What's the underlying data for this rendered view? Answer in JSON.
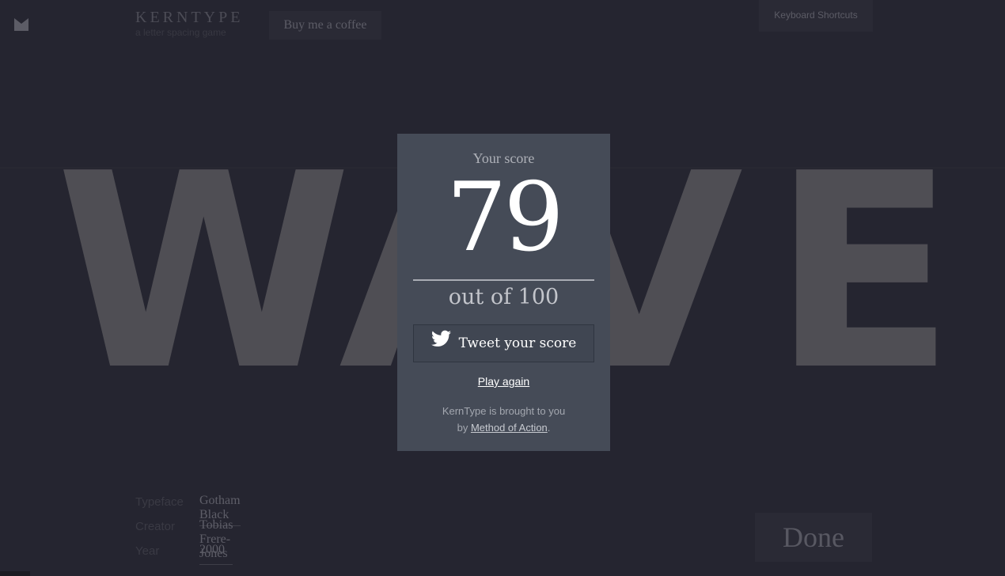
{
  "header": {
    "logo_icon": "m-logo-icon",
    "brand_title": "KERNTYPE",
    "brand_subtitle": "a letter spacing game",
    "coffee_label": "Buy me a coffee",
    "shortcuts_label": "Keyboard Shortcuts"
  },
  "game": {
    "word_letters": [
      "W",
      "A",
      "V",
      "E"
    ]
  },
  "meta": {
    "typeface_label": "Typeface",
    "typeface_value": "Gotham Black",
    "creator_label": "Creator",
    "creator_value": "Tobias Frere-Jones",
    "year_label": "Year",
    "year_value": "2000"
  },
  "done_label": "Done",
  "score_panel": {
    "label": "Your score",
    "score": "79",
    "total": "out of 100",
    "tweet_icon": "twitter-bird-icon",
    "tweet_label": "Tweet your score",
    "play_again": "Play again",
    "credit_line1": "KernType is brought to you",
    "credit_by": "by ",
    "credit_link": "Method of Action",
    "credit_end": "."
  },
  "colors": {
    "background": "#252530",
    "panel": "#454b57",
    "letters": "#4f4e54"
  }
}
